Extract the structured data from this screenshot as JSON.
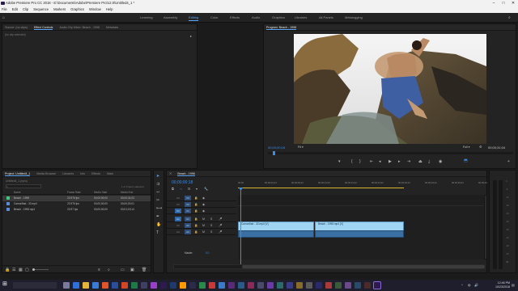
{
  "app": {
    "title": "Adobe Premiere Pro CC 2018 - E:\\Documents\\Adobe\\Premiere Pro\\12.0\\Untitled4_1 *"
  },
  "menu": [
    "File",
    "Edit",
    "Clip",
    "Sequence",
    "Markers",
    "Graphics",
    "Window",
    "Help"
  ],
  "workspaces": [
    "Learning",
    "Assembly",
    "Editing",
    "Color",
    "Effects",
    "Audio",
    "Graphics",
    "Libraries",
    "All Panels",
    "Metalogging"
  ],
  "active_workspace": "Editing",
  "source_panel": {
    "tabs": [
      "Source: (no clips)",
      "Effect Controls",
      "Audio Clip Mixer: Beach - 1998",
      "Metadata"
    ],
    "active": "Effect Controls",
    "empty_text": "(no clip selected)"
  },
  "program": {
    "tab": "Program: Beach - 1998",
    "timecode": "00;00;00;18",
    "fit": "Fit",
    "quality": "Full",
    "duration": "00;00;31;04"
  },
  "project": {
    "tabs": [
      "Project: Untitled4_1",
      "Media Browser",
      "Libraries",
      "Info",
      "Effects",
      "Mark"
    ],
    "active": "Project: Untitled4_1",
    "file": "Untitled4_1.prproj",
    "items_selected": "1 of 3 items selected",
    "columns": [
      "Name",
      "Frame Rate",
      "Media Start",
      "Media End"
    ],
    "rows": [
      {
        "name": "Beach - 1998",
        "fps": "23.976 fps",
        "start": "00;00;00;00",
        "end": "00;00;31;03",
        "color": "#3fc87a",
        "selected": true
      },
      {
        "name": "Camorillad - 32.mp4",
        "fps": "23.976 fps",
        "start": "00;00;00;00",
        "end": "00;00;20;01",
        "color": "#5a8ad8",
        "selected": false
      },
      {
        "name": "Beach - 1998.mp4",
        "fps": "23.97 fps",
        "start": "00;00;00;00",
        "end": "00;01;19;14",
        "color": "#5a8ad8",
        "selected": false
      }
    ]
  },
  "timeline": {
    "tab": "Beach - 1998",
    "timecode": "00;00;00;18",
    "ruler": [
      "00;00",
      "00;00;04;23",
      "00;00;09;23",
      "00;00;14;23",
      "00;00;19;22",
      "00;00;24;22",
      "00;00;29;22",
      "00;00;34;22",
      "00;00;39;21",
      "00;00;44"
    ],
    "tracks": [
      "V3",
      "V2",
      "V1",
      "A1",
      "A2",
      "A3"
    ],
    "master": "Master",
    "master_value": "0.0",
    "clips": [
      {
        "label": "Camorillad - 32.mp4 [V]"
      },
      {
        "label": "Beach - 1998.mp4 [V]"
      }
    ]
  },
  "meter": {
    "labels": [
      "0",
      "-6",
      "-12",
      "-18",
      "-24",
      "-30",
      "-36",
      "-42",
      "-48",
      "-54",
      "dB"
    ]
  },
  "clock": {
    "time": "12:46 PM",
    "date": "10/23/2018"
  }
}
